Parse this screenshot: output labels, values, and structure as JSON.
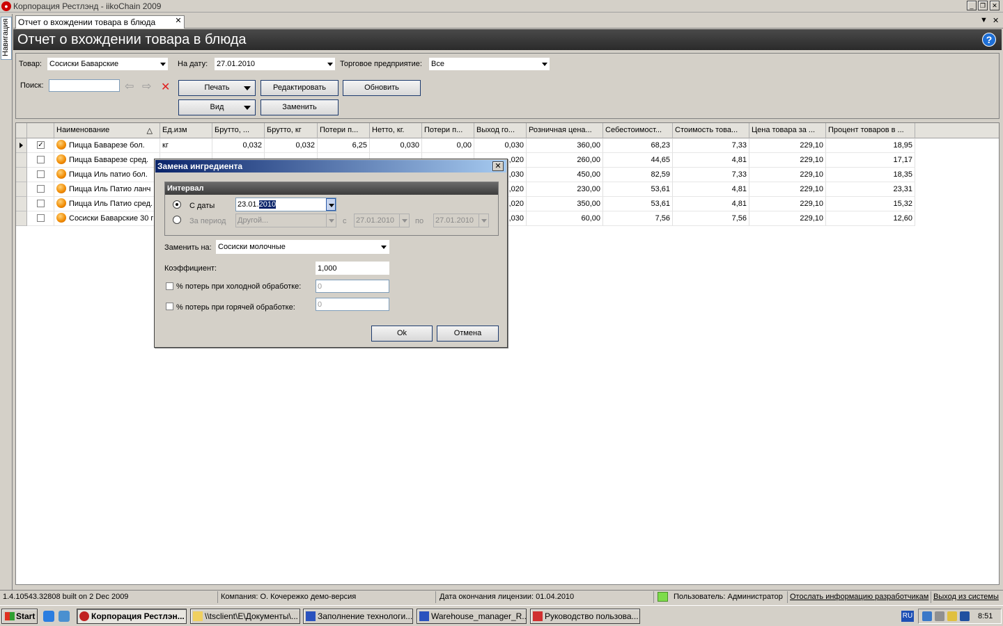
{
  "window": {
    "title": "Корпорация Рестлэнд - iikoChain 2009",
    "minimize": "_",
    "restore": "❐",
    "close": "✕"
  },
  "nav": {
    "side_tab": "Навигация"
  },
  "doc_tab": {
    "label": "Отчет о вхождении товара в блюда",
    "close": "✕"
  },
  "header": {
    "title": "Отчет о вхождении товара в блюда",
    "help": "?"
  },
  "filters": {
    "product_label": "Товар:",
    "product_value": "Сосиски Баварские",
    "date_label": "На дату:",
    "date_value": "27.01.2010",
    "store_label": "Торговое предприятие:",
    "store_value": "Все",
    "search_label": "Поиск:",
    "search_value": ""
  },
  "toolbar": {
    "print": "Печать",
    "edit": "Редактировать",
    "refresh": "Обновить",
    "view": "Вид",
    "replace": "Заменить"
  },
  "grid": {
    "columns": [
      "Наименование",
      "Ед.изм",
      "Брутто, ...",
      "Брутто, кг",
      "Потери п...",
      "Нетто, кг.",
      "Потери п...",
      "Выход го...",
      "Розничная цена...",
      "Себестоимост...",
      "Стоимость това...",
      "Цена товара за ...",
      "Процент товаров в ..."
    ],
    "sort_indicator": "△",
    "rows": [
      {
        "checked": true,
        "name": "Пицца Баварезе бол.",
        "unit": "кг",
        "brutto": "0,032",
        "brutto_kg": "0,032",
        "loss1": "6,25",
        "netto": "0,030",
        "loss2": "0,00",
        "yield": "0,030",
        "retail": "360,00",
        "cost": "68,23",
        "goods_cost": "7,33",
        "price": "229,10",
        "percent": "18,95"
      },
      {
        "checked": false,
        "name": "Пицца Баварезе сред.",
        "unit": "",
        "brutto": "",
        "brutto_kg": "",
        "loss1": "",
        "netto": "",
        "loss2": "",
        "yield": ",020",
        "retail": "260,00",
        "cost": "44,65",
        "goods_cost": "4,81",
        "price": "229,10",
        "percent": "17,17"
      },
      {
        "checked": false,
        "name": "Пицца Иль патио бол.",
        "unit": "",
        "brutto": "",
        "brutto_kg": "",
        "loss1": "",
        "netto": "",
        "loss2": "",
        "yield": ",030",
        "retail": "450,00",
        "cost": "82,59",
        "goods_cost": "7,33",
        "price": "229,10",
        "percent": "18,35"
      },
      {
        "checked": false,
        "name": "Пицца Иль Патио ланч",
        "unit": "",
        "brutto": "",
        "brutto_kg": "",
        "loss1": "",
        "netto": "",
        "loss2": "",
        "yield": ",020",
        "retail": "230,00",
        "cost": "53,61",
        "goods_cost": "4,81",
        "price": "229,10",
        "percent": "23,31"
      },
      {
        "checked": false,
        "name": "Пицца Иль Патио сред.",
        "unit": "",
        "brutto": "",
        "brutto_kg": "",
        "loss1": "",
        "netto": "",
        "loss2": "",
        "yield": ",020",
        "retail": "350,00",
        "cost": "53,61",
        "goods_cost": "4,81",
        "price": "229,10",
        "percent": "15,32"
      },
      {
        "checked": false,
        "name": "Сосиски Баварские 30 г",
        "unit": "",
        "brutto": "",
        "brutto_kg": "",
        "loss1": "",
        "netto": "",
        "loss2": "",
        "yield": ",030",
        "retail": "60,00",
        "cost": "7,56",
        "goods_cost": "7,56",
        "price": "229,10",
        "percent": "12,60"
      }
    ]
  },
  "dialog": {
    "title": "Замена ингредиента",
    "close": "✕",
    "group_title": "Интервал",
    "from_date_label": "С даты",
    "from_date_prefix": "23.01.",
    "from_date_selected": "2010",
    "period_label": "За период",
    "period_value": "Другой...",
    "period_from_label": "с",
    "period_from_value": "27.01.2010",
    "period_to_label": "по",
    "period_to_value": "27.01.2010",
    "replace_with_label": "Заменить на:",
    "replace_with_value": "Сосиски молочные",
    "coef_label": "Коэффициент:",
    "coef_value": "1,000",
    "cold_loss_label": "% потерь при холодной обработке:",
    "cold_loss_value": "0",
    "hot_loss_label": "% потерь при горячей обработке:",
    "hot_loss_value": "0",
    "ok": "Ok",
    "cancel": "Отмена"
  },
  "status": {
    "build": "1.4.10543.32808 built on 2 Dec 2009",
    "company": "Компания: О. Кочережко демо-версия",
    "license": "Дата окончания лицензии: 01.04.2010",
    "user": "Пользователь: Администратор",
    "send_info": "Отослать информацию разработчикам",
    "logout": "Выход из системы"
  },
  "taskbar": {
    "start": "Start",
    "tasks": [
      "Корпорация Рестлэн...",
      "\\\\tsclient\\E\\Документы\\...",
      "Заполнение технологи...",
      "Warehouse_manager_R...",
      "Руководство пользова..."
    ],
    "lang": "RU",
    "clock": "8:51"
  }
}
